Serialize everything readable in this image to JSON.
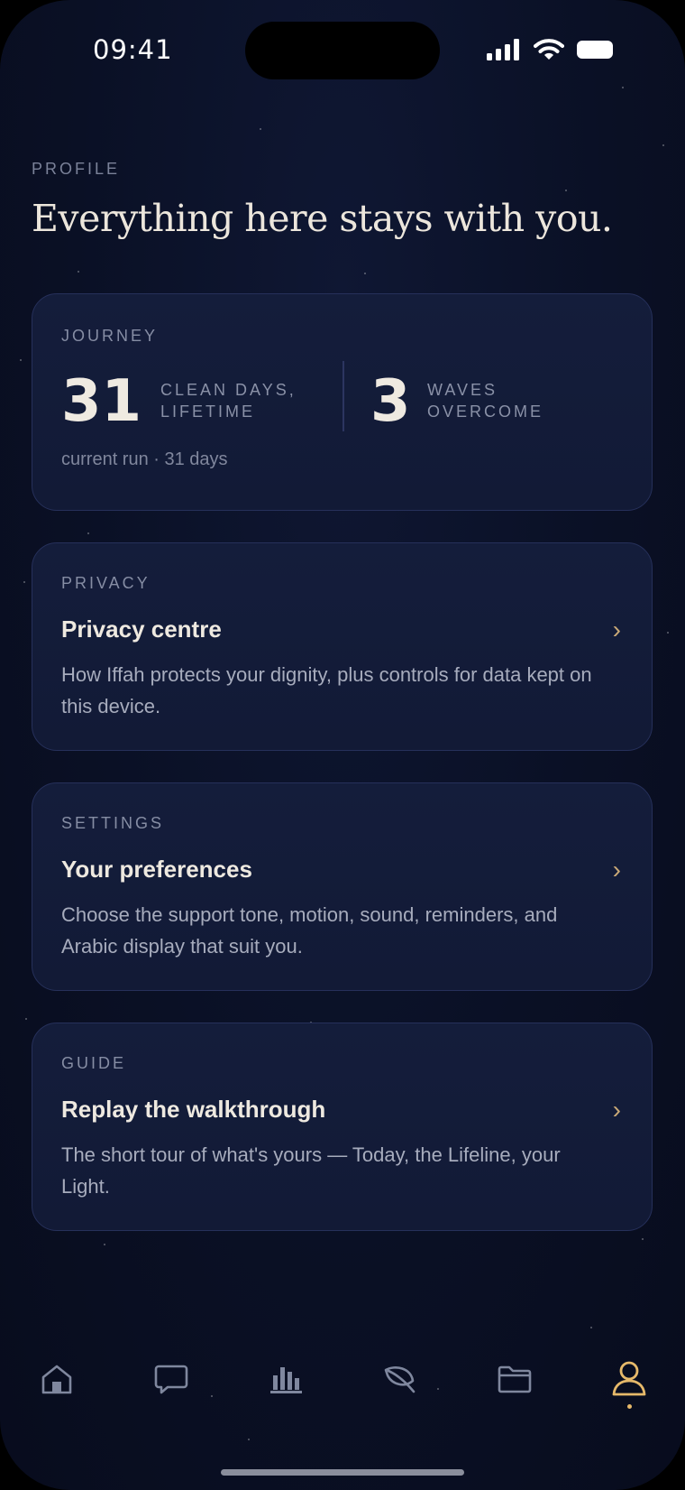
{
  "status_bar": {
    "time": "09:41"
  },
  "header": {
    "eyebrow": "PROFILE",
    "headline": "Everything here stays with you."
  },
  "journey": {
    "label": "JOURNEY",
    "clean_days": "31",
    "clean_days_label": "CLEAN DAYS, LIFETIME",
    "waves": "3",
    "waves_label": "WAVES OVERCOME",
    "footer": "current run · 31 days"
  },
  "privacy": {
    "label": "PRIVACY",
    "title": "Privacy centre",
    "description": "How Iffah protects your dignity, plus controls for data kept on this device.",
    "chevron": "›"
  },
  "settings": {
    "label": "SETTINGS",
    "title": "Your preferences",
    "description": "Choose the support tone, motion, sound, reminders, and Arabic display that suit you.",
    "chevron": "›"
  },
  "guide": {
    "label": "GUIDE",
    "title": "Replay the walkthrough",
    "description": "The short tour of what's yours — Today, the Lifeline, your Light.",
    "chevron": "›"
  },
  "tab_bar": {
    "tabs": [
      {
        "icon": "home-icon",
        "active": false
      },
      {
        "icon": "chat-bubble-icon",
        "active": false
      },
      {
        "icon": "bar-chart-icon",
        "active": false
      },
      {
        "icon": "leaf-icon",
        "active": false
      },
      {
        "icon": "folder-icon",
        "active": false
      },
      {
        "icon": "person-icon",
        "active": true
      }
    ]
  },
  "colors": {
    "background": "#0a1025",
    "card": "#141d3b",
    "accent_gold": "#e6b96a",
    "chevron": "#c9a977",
    "inactive_icon": "#8a91a7"
  }
}
